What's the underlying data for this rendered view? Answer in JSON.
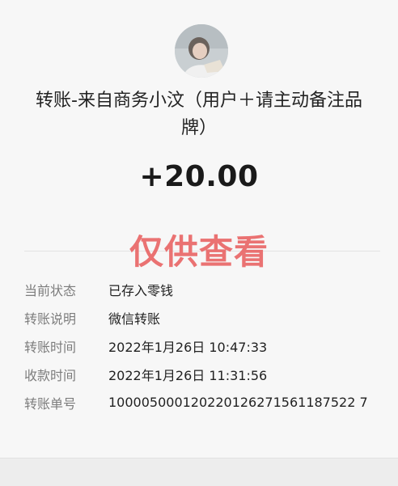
{
  "transfer": {
    "title": "转账-来自商务小汶（用户＋请主动备注品牌）",
    "amount": "+20.00",
    "watermark": "仅供查看"
  },
  "details": [
    {
      "label": "当前状态",
      "value": "已存入零钱"
    },
    {
      "label": "转账说明",
      "value": "微信转账"
    },
    {
      "label": "转账时间",
      "value": "2022年1月26日 10:47:33"
    },
    {
      "label": "收款时间",
      "value": "2022年1月26日 11:31:56"
    },
    {
      "label": "转账单号",
      "value": "100005000120220126271561187522 7"
    }
  ],
  "colors": {
    "background": "#f7f7f7",
    "watermark": "#e86060",
    "label": "#7d7d7d"
  }
}
